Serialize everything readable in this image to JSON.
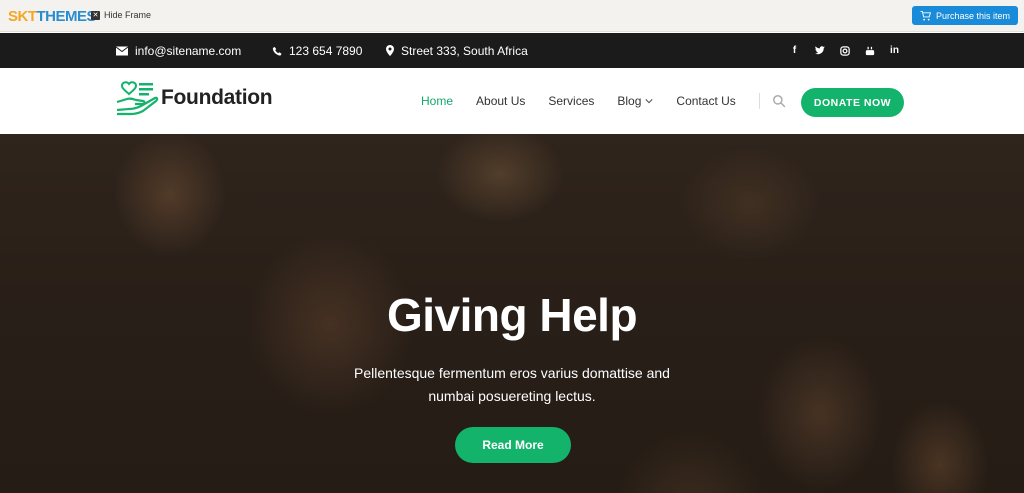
{
  "frame": {
    "logo_part1": "SKT",
    "logo_part2": "THEMES",
    "hide_frame_label": "Hide Frame",
    "purchase_label": "Purchase this item"
  },
  "topbar": {
    "email": "info@sitename.com",
    "phone": "123 654 7890",
    "address": "Street 333, South Africa",
    "socials": [
      "facebook-icon",
      "twitter-icon",
      "instagram-icon",
      "youtube-icon",
      "linkedin-icon"
    ]
  },
  "header": {
    "brand": "Foundation",
    "nav": [
      {
        "label": "Home",
        "active": true
      },
      {
        "label": "About Us",
        "active": false
      },
      {
        "label": "Services",
        "active": false
      },
      {
        "label": "Blog",
        "active": false,
        "dropdown": true
      },
      {
        "label": "Contact Us",
        "active": false
      }
    ],
    "donate_label": "DONATE NOW"
  },
  "hero": {
    "title": "Giving Help",
    "subtitle_line1": "Pellentesque fermentum eros varius domattise and",
    "subtitle_line2": "numbai posuereting lectus.",
    "button_label": "Read More"
  },
  "colors": {
    "accent": "#13b36b",
    "topbar_bg": "#1b1b1b",
    "purchase_bg": "#1a8bd8"
  }
}
